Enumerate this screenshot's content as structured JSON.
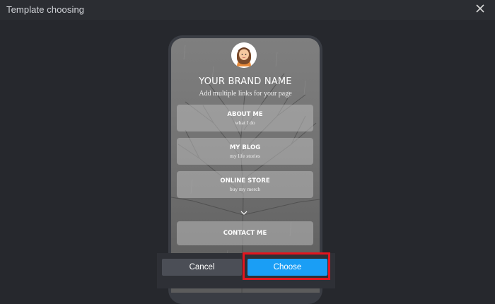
{
  "dialog": {
    "title": "Template choosing",
    "close_icon": "close-icon"
  },
  "preview": {
    "avatar_icon": "avatar-girl-icon",
    "brand_name": "YOUR BRAND NAME",
    "tagline": "Add multiple links for your page",
    "links": [
      {
        "title": "ABOUT ME",
        "subtitle": "what I do"
      },
      {
        "title": "MY BLOG",
        "subtitle": "my life stories"
      },
      {
        "title": "ONLINE STORE",
        "subtitle": "buy my merch"
      },
      {
        "title": "CONTACT ME",
        "subtitle": ""
      }
    ],
    "more_icon": "chevron-down-icon"
  },
  "actions": {
    "cancel_label": "Cancel",
    "choose_label": "Choose"
  },
  "colors": {
    "background": "#26282d",
    "accent": "#1a9ef5",
    "highlight": "#e3151e"
  }
}
